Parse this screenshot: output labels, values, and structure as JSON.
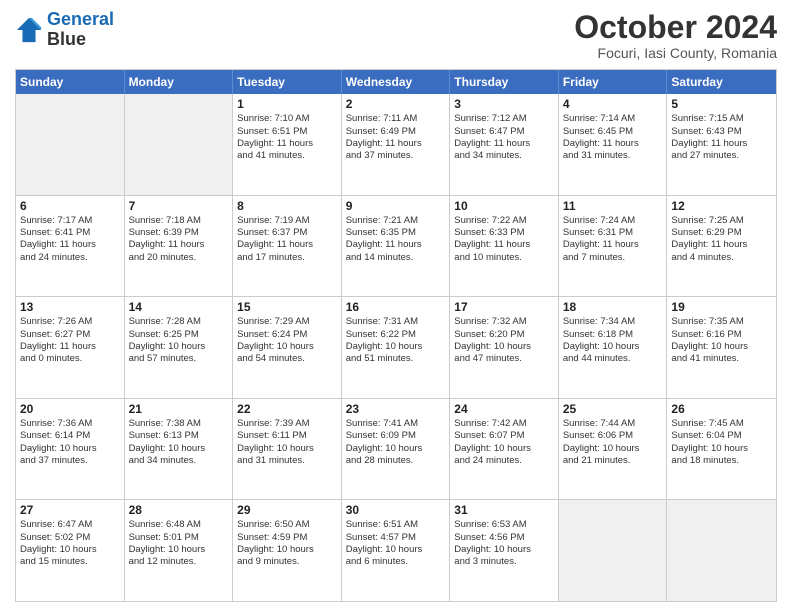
{
  "logo": {
    "line1": "General",
    "line2": "Blue"
  },
  "title": "October 2024",
  "subtitle": "Focuri, Iasi County, Romania",
  "header_days": [
    "Sunday",
    "Monday",
    "Tuesday",
    "Wednesday",
    "Thursday",
    "Friday",
    "Saturday"
  ],
  "rows": [
    [
      {
        "day": "",
        "lines": [],
        "shaded": true
      },
      {
        "day": "",
        "lines": [],
        "shaded": true
      },
      {
        "day": "1",
        "lines": [
          "Sunrise: 7:10 AM",
          "Sunset: 6:51 PM",
          "Daylight: 11 hours",
          "and 41 minutes."
        ]
      },
      {
        "day": "2",
        "lines": [
          "Sunrise: 7:11 AM",
          "Sunset: 6:49 PM",
          "Daylight: 11 hours",
          "and 37 minutes."
        ]
      },
      {
        "day": "3",
        "lines": [
          "Sunrise: 7:12 AM",
          "Sunset: 6:47 PM",
          "Daylight: 11 hours",
          "and 34 minutes."
        ]
      },
      {
        "day": "4",
        "lines": [
          "Sunrise: 7:14 AM",
          "Sunset: 6:45 PM",
          "Daylight: 11 hours",
          "and 31 minutes."
        ]
      },
      {
        "day": "5",
        "lines": [
          "Sunrise: 7:15 AM",
          "Sunset: 6:43 PM",
          "Daylight: 11 hours",
          "and 27 minutes."
        ]
      }
    ],
    [
      {
        "day": "6",
        "lines": [
          "Sunrise: 7:17 AM",
          "Sunset: 6:41 PM",
          "Daylight: 11 hours",
          "and 24 minutes."
        ]
      },
      {
        "day": "7",
        "lines": [
          "Sunrise: 7:18 AM",
          "Sunset: 6:39 PM",
          "Daylight: 11 hours",
          "and 20 minutes."
        ]
      },
      {
        "day": "8",
        "lines": [
          "Sunrise: 7:19 AM",
          "Sunset: 6:37 PM",
          "Daylight: 11 hours",
          "and 17 minutes."
        ]
      },
      {
        "day": "9",
        "lines": [
          "Sunrise: 7:21 AM",
          "Sunset: 6:35 PM",
          "Daylight: 11 hours",
          "and 14 minutes."
        ]
      },
      {
        "day": "10",
        "lines": [
          "Sunrise: 7:22 AM",
          "Sunset: 6:33 PM",
          "Daylight: 11 hours",
          "and 10 minutes."
        ]
      },
      {
        "day": "11",
        "lines": [
          "Sunrise: 7:24 AM",
          "Sunset: 6:31 PM",
          "Daylight: 11 hours",
          "and 7 minutes."
        ]
      },
      {
        "day": "12",
        "lines": [
          "Sunrise: 7:25 AM",
          "Sunset: 6:29 PM",
          "Daylight: 11 hours",
          "and 4 minutes."
        ]
      }
    ],
    [
      {
        "day": "13",
        "lines": [
          "Sunrise: 7:26 AM",
          "Sunset: 6:27 PM",
          "Daylight: 11 hours",
          "and 0 minutes."
        ]
      },
      {
        "day": "14",
        "lines": [
          "Sunrise: 7:28 AM",
          "Sunset: 6:25 PM",
          "Daylight: 10 hours",
          "and 57 minutes."
        ]
      },
      {
        "day": "15",
        "lines": [
          "Sunrise: 7:29 AM",
          "Sunset: 6:24 PM",
          "Daylight: 10 hours",
          "and 54 minutes."
        ]
      },
      {
        "day": "16",
        "lines": [
          "Sunrise: 7:31 AM",
          "Sunset: 6:22 PM",
          "Daylight: 10 hours",
          "and 51 minutes."
        ]
      },
      {
        "day": "17",
        "lines": [
          "Sunrise: 7:32 AM",
          "Sunset: 6:20 PM",
          "Daylight: 10 hours",
          "and 47 minutes."
        ]
      },
      {
        "day": "18",
        "lines": [
          "Sunrise: 7:34 AM",
          "Sunset: 6:18 PM",
          "Daylight: 10 hours",
          "and 44 minutes."
        ]
      },
      {
        "day": "19",
        "lines": [
          "Sunrise: 7:35 AM",
          "Sunset: 6:16 PM",
          "Daylight: 10 hours",
          "and 41 minutes."
        ]
      }
    ],
    [
      {
        "day": "20",
        "lines": [
          "Sunrise: 7:36 AM",
          "Sunset: 6:14 PM",
          "Daylight: 10 hours",
          "and 37 minutes."
        ]
      },
      {
        "day": "21",
        "lines": [
          "Sunrise: 7:38 AM",
          "Sunset: 6:13 PM",
          "Daylight: 10 hours",
          "and 34 minutes."
        ]
      },
      {
        "day": "22",
        "lines": [
          "Sunrise: 7:39 AM",
          "Sunset: 6:11 PM",
          "Daylight: 10 hours",
          "and 31 minutes."
        ]
      },
      {
        "day": "23",
        "lines": [
          "Sunrise: 7:41 AM",
          "Sunset: 6:09 PM",
          "Daylight: 10 hours",
          "and 28 minutes."
        ]
      },
      {
        "day": "24",
        "lines": [
          "Sunrise: 7:42 AM",
          "Sunset: 6:07 PM",
          "Daylight: 10 hours",
          "and 24 minutes."
        ]
      },
      {
        "day": "25",
        "lines": [
          "Sunrise: 7:44 AM",
          "Sunset: 6:06 PM",
          "Daylight: 10 hours",
          "and 21 minutes."
        ]
      },
      {
        "day": "26",
        "lines": [
          "Sunrise: 7:45 AM",
          "Sunset: 6:04 PM",
          "Daylight: 10 hours",
          "and 18 minutes."
        ]
      }
    ],
    [
      {
        "day": "27",
        "lines": [
          "Sunrise: 6:47 AM",
          "Sunset: 5:02 PM",
          "Daylight: 10 hours",
          "and 15 minutes."
        ]
      },
      {
        "day": "28",
        "lines": [
          "Sunrise: 6:48 AM",
          "Sunset: 5:01 PM",
          "Daylight: 10 hours",
          "and 12 minutes."
        ]
      },
      {
        "day": "29",
        "lines": [
          "Sunrise: 6:50 AM",
          "Sunset: 4:59 PM",
          "Daylight: 10 hours",
          "and 9 minutes."
        ]
      },
      {
        "day": "30",
        "lines": [
          "Sunrise: 6:51 AM",
          "Sunset: 4:57 PM",
          "Daylight: 10 hours",
          "and 6 minutes."
        ]
      },
      {
        "day": "31",
        "lines": [
          "Sunrise: 6:53 AM",
          "Sunset: 4:56 PM",
          "Daylight: 10 hours",
          "and 3 minutes."
        ]
      },
      {
        "day": "",
        "lines": [],
        "shaded": true
      },
      {
        "day": "",
        "lines": [],
        "shaded": true
      }
    ]
  ]
}
